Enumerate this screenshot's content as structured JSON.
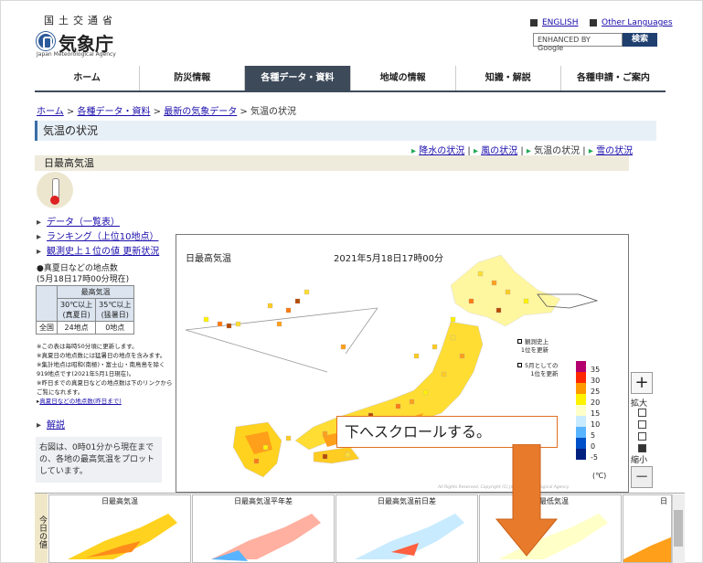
{
  "header": {
    "org_top": "国土交通省",
    "org_main": "気象庁",
    "org_sub": "Japan Meteorological Agency",
    "lang_en": "ENGLISH",
    "lang_other": "Other Languages",
    "search_placeholder": "ENHANCED BY Google",
    "search_button": "検索"
  },
  "nav": {
    "items": [
      "ホーム",
      "防災情報",
      "各種データ・資料",
      "地域の情報",
      "知識・解説",
      "各種申請・ご案内"
    ],
    "active": 2
  },
  "breadcrumb": {
    "home": "ホーム",
    "data": "各種データ・資料",
    "latest": "最新の気象データ",
    "current": "気温の状況",
    "sep": " > "
  },
  "page_title": "気温の状況",
  "sub_links": {
    "rain": "降水の状況",
    "wind": "風の状況",
    "temp": "気温の状況",
    "snow": "雪の状況",
    "sep": " | "
  },
  "section_title": "日最高気温",
  "side_links": [
    "データ（一覧表）",
    "ランキング（上位10地点）",
    "観測史上１位の値 更新状況"
  ],
  "counts": {
    "title": "●真夏日などの地点数",
    "subtitle": "(5月18日17時00分現在)",
    "header_main": "最高気温",
    "col1_top": "30℃以上",
    "col1_bottom": "(真夏日)",
    "col2_top": "35℃以上",
    "col2_bottom": "(猛暑日)",
    "row_label": "全国",
    "col1_value": "24地点",
    "col2_value": "0地点"
  },
  "notes": [
    "※この表は毎時50分頃に更新します。",
    "※真夏日の地点数には猛暑日の地点を含みます。",
    "※集計地点は昭和(南極)・富士山・南鳥島を除く919地点です(2021年5月1日現在)。",
    "※昨日までの真夏日などの地点数は下のリンクからご覧になれます。"
  ],
  "notes_link": "真夏日などの地点数(昨日まで)",
  "explain_link": "解説",
  "description": "右図は、0時01分から現在までの、各地の最高気温をプロットしています。",
  "map": {
    "title": "日最高気温",
    "time": "2021年5月18日17時00分",
    "legend_record_a": "観測史上",
    "legend_record_b": "1位を更新",
    "legend_month_a": "5月としての",
    "legend_month_b": "1位を更新",
    "scale": [
      {
        "label": "35",
        "color": "#b4006e"
      },
      {
        "label": "30",
        "color": "#ff2800"
      },
      {
        "label": "25",
        "color": "#ff9900"
      },
      {
        "label": "20",
        "color": "#fff200"
      },
      {
        "label": "15",
        "color": "#ffffc8"
      },
      {
        "label": "10",
        "color": "#c8ebff"
      },
      {
        "label": "5",
        "color": "#59b4ff"
      },
      {
        "label": "0",
        "color": "#0050c8"
      },
      {
        "label": "-5",
        "color": "#002080"
      }
    ],
    "unit": "(℃)",
    "copyright": "All Rights Reserved, Copyright (C) Japan Meteorological Agency"
  },
  "zoom": {
    "in_label": "拡大",
    "out_label": "縮小",
    "plus": "+",
    "minus": "−",
    "level": 4,
    "levels": 4
  },
  "callout": "下へスクロールする。",
  "thumbnails": {
    "side_label": "今日の値",
    "items": [
      "日最高気温",
      "日最高気温平年差",
      "日最高気温前日差",
      "日最低気温",
      "日"
    ]
  }
}
